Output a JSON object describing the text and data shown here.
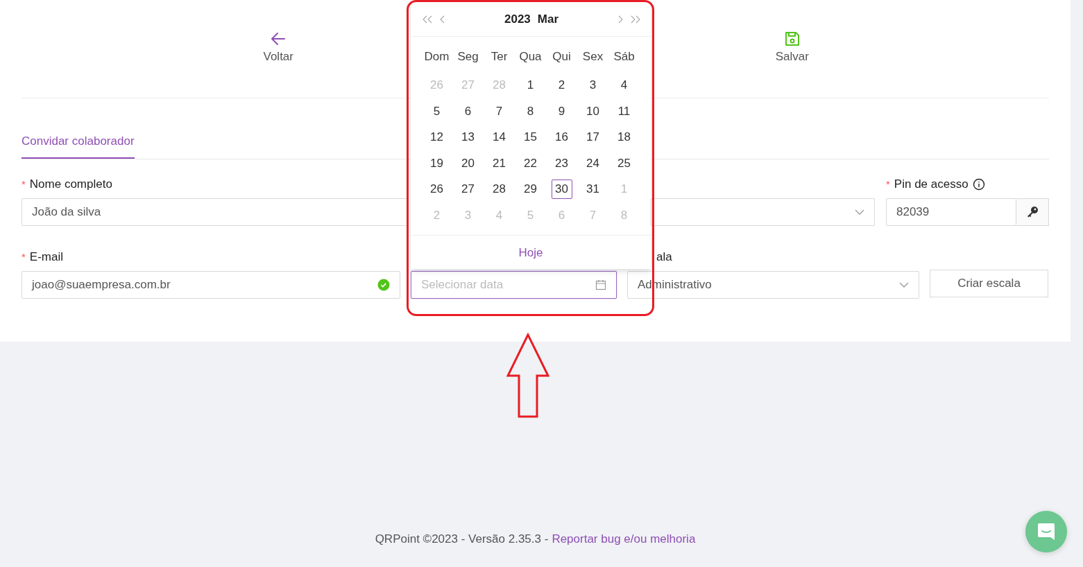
{
  "toolbar": [
    {
      "kind": "back",
      "label": "Voltar"
    },
    {
      "kind": "save",
      "label": "Salvar"
    }
  ],
  "tabs": [
    {
      "label": "Convidar colaborador",
      "selected": true
    }
  ],
  "form": {
    "name": {
      "label": "Nome completo",
      "required_mark": "*",
      "value": "João da silva"
    },
    "pin": {
      "label": "Pin de acesso",
      "required_mark": "*",
      "value": "82039"
    },
    "email": {
      "label": "E-mail",
      "required_mark": "*",
      "value": "joao@suaempresa.com.br",
      "valid": true
    },
    "date": {
      "placeholder": "Selecionar data"
    },
    "schedule": {
      "label": "ala",
      "value": "Administrativo"
    },
    "create_button": "Criar escala"
  },
  "calendar": {
    "year": "2023",
    "month": "Mar",
    "weekdays": [
      "Dom",
      "Seg",
      "Ter",
      "Qua",
      "Qui",
      "Sex",
      "Sáb"
    ],
    "days": [
      {
        "label": "26",
        "in_month": false,
        "selected": false
      },
      {
        "label": "27",
        "in_month": false,
        "selected": false
      },
      {
        "label": "28",
        "in_month": false,
        "selected": false
      },
      {
        "label": "1",
        "in_month": true,
        "selected": false
      },
      {
        "label": "2",
        "in_month": true,
        "selected": false
      },
      {
        "label": "3",
        "in_month": true,
        "selected": false
      },
      {
        "label": "4",
        "in_month": true,
        "selected": false
      },
      {
        "label": "5",
        "in_month": true,
        "selected": false
      },
      {
        "label": "6",
        "in_month": true,
        "selected": false
      },
      {
        "label": "7",
        "in_month": true,
        "selected": false
      },
      {
        "label": "8",
        "in_month": true,
        "selected": false
      },
      {
        "label": "9",
        "in_month": true,
        "selected": false
      },
      {
        "label": "10",
        "in_month": true,
        "selected": false
      },
      {
        "label": "11",
        "in_month": true,
        "selected": false
      },
      {
        "label": "12",
        "in_month": true,
        "selected": false
      },
      {
        "label": "13",
        "in_month": true,
        "selected": false
      },
      {
        "label": "14",
        "in_month": true,
        "selected": false
      },
      {
        "label": "15",
        "in_month": true,
        "selected": false
      },
      {
        "label": "16",
        "in_month": true,
        "selected": false
      },
      {
        "label": "17",
        "in_month": true,
        "selected": false
      },
      {
        "label": "18",
        "in_month": true,
        "selected": false
      },
      {
        "label": "19",
        "in_month": true,
        "selected": false
      },
      {
        "label": "20",
        "in_month": true,
        "selected": false
      },
      {
        "label": "21",
        "in_month": true,
        "selected": false
      },
      {
        "label": "22",
        "in_month": true,
        "selected": false
      },
      {
        "label": "23",
        "in_month": true,
        "selected": false
      },
      {
        "label": "24",
        "in_month": true,
        "selected": false
      },
      {
        "label": "25",
        "in_month": true,
        "selected": false
      },
      {
        "label": "26",
        "in_month": true,
        "selected": false
      },
      {
        "label": "27",
        "in_month": true,
        "selected": false
      },
      {
        "label": "28",
        "in_month": true,
        "selected": false
      },
      {
        "label": "29",
        "in_month": true,
        "selected": false
      },
      {
        "label": "30",
        "in_month": true,
        "selected": true
      },
      {
        "label": "31",
        "in_month": true,
        "selected": false
      },
      {
        "label": "1",
        "in_month": false,
        "selected": false
      },
      {
        "label": "2",
        "in_month": false,
        "selected": false
      },
      {
        "label": "3",
        "in_month": false,
        "selected": false
      },
      {
        "label": "4",
        "in_month": false,
        "selected": false
      },
      {
        "label": "5",
        "in_month": false,
        "selected": false
      },
      {
        "label": "6",
        "in_month": false,
        "selected": false
      },
      {
        "label": "7",
        "in_month": false,
        "selected": false
      },
      {
        "label": "8",
        "in_month": false,
        "selected": false
      }
    ],
    "today": "Hoje"
  },
  "footer": {
    "text": "QRPoint ©2023 - Versão 2.35.3 -",
    "link": "Reportar bug e/ou melhoria"
  }
}
